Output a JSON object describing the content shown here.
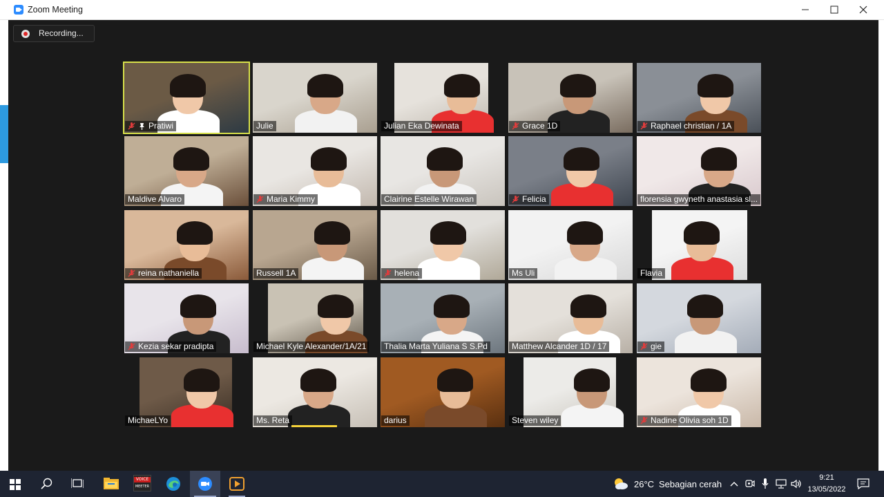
{
  "window": {
    "title": "Zoom Meeting"
  },
  "recording": {
    "label": "Recording..."
  },
  "participants": [
    {
      "name": "Pratiwi",
      "muted": true,
      "pinned": true,
      "active": true
    },
    {
      "name": "Julie",
      "muted": false
    },
    {
      "name": "Julian Eka Dewinata",
      "muted": false
    },
    {
      "name": "Grace 1D",
      "muted": true
    },
    {
      "name": "Raphael christian / 1A",
      "muted": true
    },
    {
      "name": "Maldive Alvaro",
      "muted": false
    },
    {
      "name": "Maria Kimmy",
      "muted": true
    },
    {
      "name": "Clairine Estelle Wirawan",
      "muted": false
    },
    {
      "name": "Felicia",
      "muted": true
    },
    {
      "name": "florensia gwyneth anastasia sl...",
      "muted": false
    },
    {
      "name": "reina nathaniella",
      "muted": true
    },
    {
      "name": "Russell 1A",
      "muted": false
    },
    {
      "name": "helena",
      "muted": true
    },
    {
      "name": "Ms Uli",
      "muted": false
    },
    {
      "name": "Flavia",
      "muted": false
    },
    {
      "name": "Kezia sekar pradipta",
      "muted": true
    },
    {
      "name": "Michael Kyle Alexander/1A/21",
      "muted": false
    },
    {
      "name": "Thalia Marta Yuliana S S.Pd",
      "muted": false
    },
    {
      "name": "Matthew Alcander 1D / 17",
      "muted": false
    },
    {
      "name": "gie",
      "muted": true
    },
    {
      "name": "MichaeLYo",
      "muted": false
    },
    {
      "name": "Ms. Reta",
      "muted": false,
      "speaking": true
    },
    {
      "name": "darius",
      "muted": false
    },
    {
      "name": "Steven wiley",
      "muted": false
    },
    {
      "name": "Nadine Olivia soh 1D",
      "muted": true
    }
  ],
  "taskbar": {
    "apps": [
      "start-icon",
      "search-icon",
      "task-view-icon",
      "file-explorer-icon",
      "voicemeeter-icon",
      "edge-icon",
      "zoom-icon",
      "media-player-icon"
    ],
    "voicemeeter_label_1": "VOICE",
    "voicemeeter_label_2": "MEETER",
    "weather_temp": "26°C",
    "weather_desc": "Sebagian cerah",
    "time": "9:21",
    "date": "13/05/2022"
  },
  "colors": {
    "meeting_bg": "#1a1a1a",
    "active_speaker_border": "#d7e04a",
    "muted_icon": "#e03c3c",
    "taskbar_bg": "#1e2432",
    "zoom_blue": "#2d8cff"
  }
}
